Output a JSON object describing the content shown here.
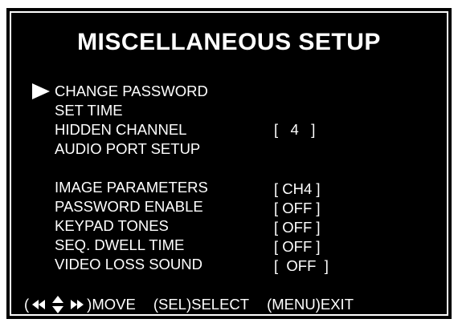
{
  "title": "MISCELLANEOUS SETUP",
  "cursor_icon": "triangle-right-icon",
  "menu": [
    {
      "label": "CHANGE PASSWORD",
      "value": "",
      "selected": true
    },
    {
      "label": "SET TIME",
      "value": ""
    },
    {
      "label": "HIDDEN CHANNEL",
      "value": "[   4   ]"
    },
    {
      "label": "AUDIO PORT SETUP",
      "value": ""
    },
    {
      "label": "IMAGE PARAMETERS",
      "value": "[ CH4 ]"
    },
    {
      "label": "PASSWORD ENABLE",
      "value": "[ OFF ]"
    },
    {
      "label": "KEYPAD TONES",
      "value": "[ OFF ]"
    },
    {
      "label": "SEQ. DWELL TIME",
      "value": "[ OFF ]"
    },
    {
      "label": "VIDEO LOSS SOUND",
      "value": "[  OFF  ]"
    }
  ],
  "footer": {
    "open_paren": "(",
    "nav_icon": "arrow-keys-icon",
    "move": ")MOVE",
    "select": "(SEL)SELECT",
    "exit": "(MENU)EXIT"
  },
  "colors": {
    "background": "#000000",
    "text": "#ffffff"
  }
}
